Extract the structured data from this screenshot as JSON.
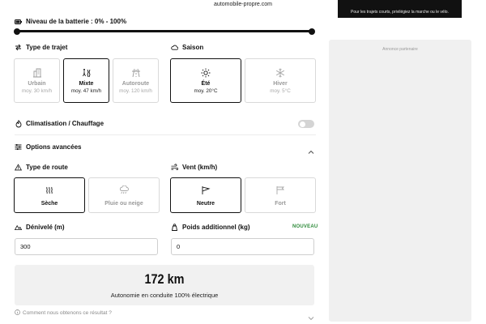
{
  "header": {
    "domain": "automobile-propre.com"
  },
  "battery": {
    "label": "Niveau de la batterie : 0% - 100%",
    "min_percent": 0,
    "max_percent": 100
  },
  "trip": {
    "label": "Type de trajet",
    "options": [
      {
        "label": "Urbain",
        "sub": "moy. 30 km/h",
        "selected": false
      },
      {
        "label": "Mixte",
        "sub": "moy. 47 km/h",
        "selected": true
      },
      {
        "label": "Autoroute",
        "sub": "moy. 120 km/h",
        "selected": false
      }
    ]
  },
  "season": {
    "label": "Saison",
    "options": [
      {
        "label": "Été",
        "sub": "moy. 20°C",
        "selected": true
      },
      {
        "label": "Hiver",
        "sub": "moy. 5°C",
        "selected": false
      }
    ]
  },
  "climate": {
    "label": "Climatisation / Chauffage",
    "enabled": false
  },
  "advanced": {
    "label": "Options avancées",
    "expanded": true
  },
  "road": {
    "label": "Type de route",
    "options": [
      {
        "label": "Sèche",
        "selected": true
      },
      {
        "label": "Pluie ou neige",
        "selected": false
      }
    ]
  },
  "wind": {
    "label": "Vent (km/h)",
    "options": [
      {
        "label": "Neutre",
        "selected": true
      },
      {
        "label": "Fort",
        "selected": false
      }
    ]
  },
  "elevation": {
    "label": "Dénivelé (m)",
    "value": "300"
  },
  "weight": {
    "label": "Poids additionnel (kg)",
    "value": "0",
    "badge": "NOUVEAU"
  },
  "result": {
    "value": "172 km",
    "description": "Autonomie en conduite 100% électrique"
  },
  "footer": {
    "link": "Comment nous obtenons ce résultat ?"
  },
  "right": {
    "banner_text": "Pour les trajets courts, privilégiez la marche ou le vélo.",
    "ad_label": "Annonce partenaire"
  },
  "colors": {
    "accent": "#111111",
    "badge": "#2e8b3a",
    "panel": "#f0f0f0"
  }
}
